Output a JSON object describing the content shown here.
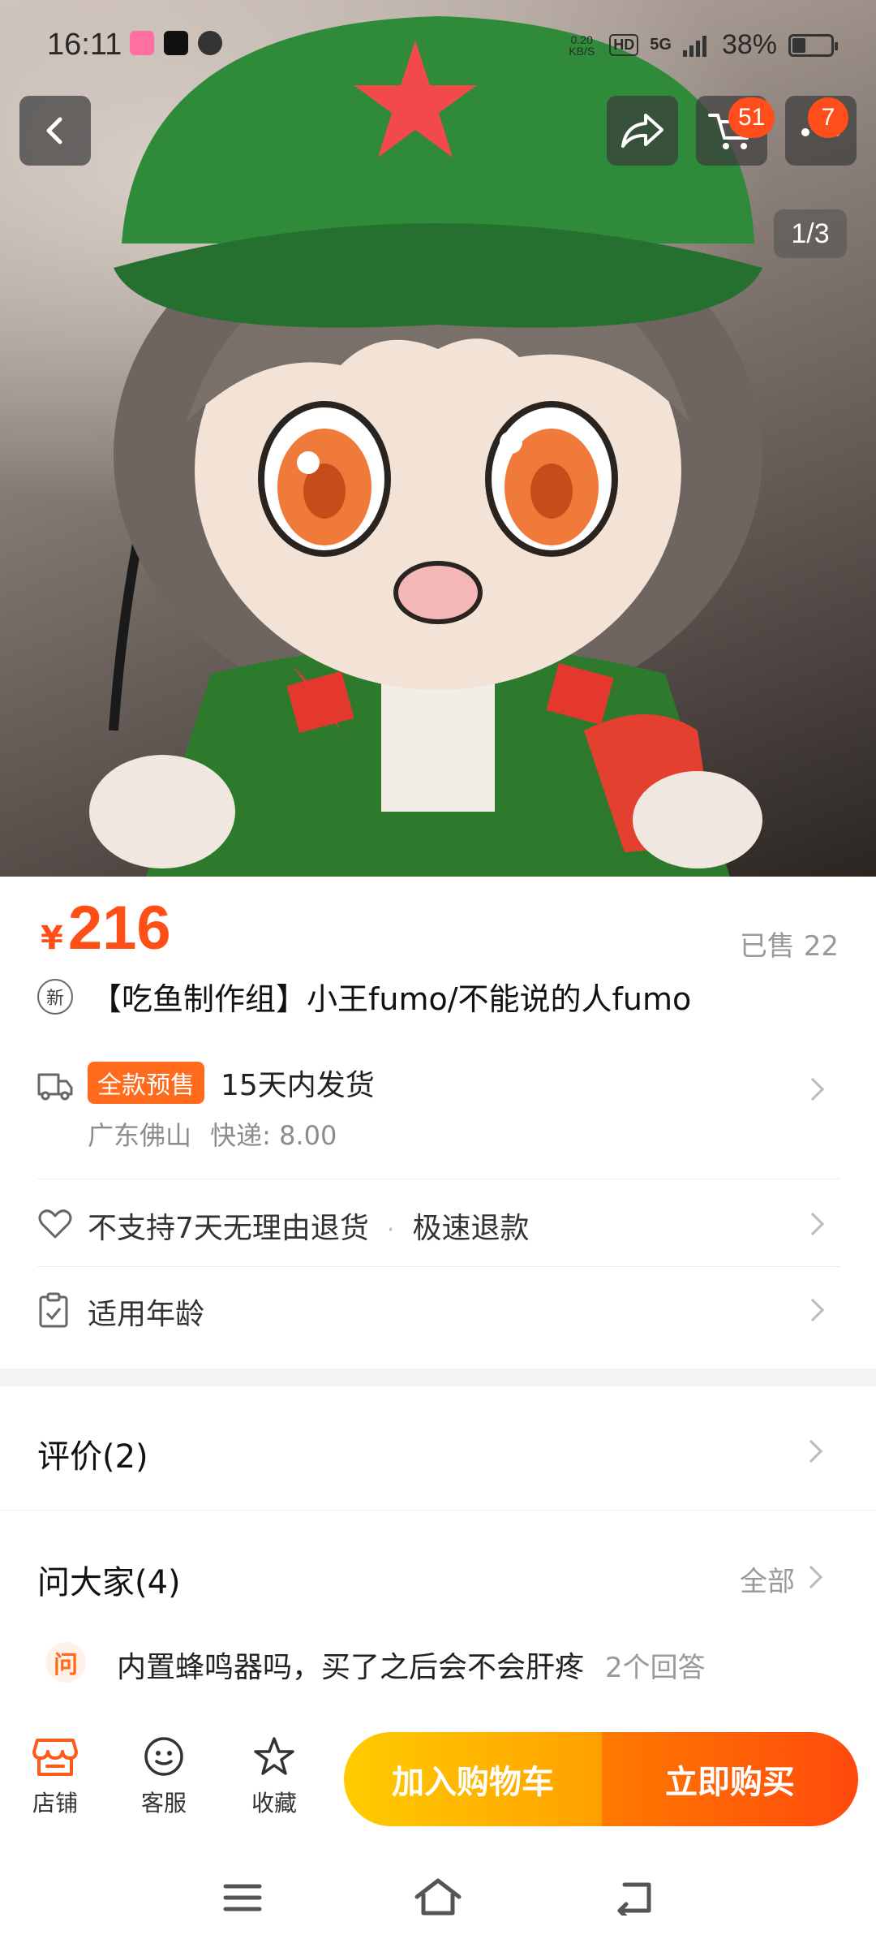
{
  "status_bar": {
    "time": "16:11",
    "net_speed_value": "0.20",
    "net_speed_unit": "KB/S",
    "hd_label": "HD",
    "network": "5G",
    "battery": "38%"
  },
  "top_bar": {
    "cart_count": "51",
    "more_count": "7",
    "pager": "1/3"
  },
  "product": {
    "currency": "¥",
    "price": "216",
    "sold": "已售 22",
    "new_label": "新",
    "title": "【吃鱼制作组】小王fumo/不能说的人fumo"
  },
  "shipping": {
    "presale_tag": "全款预售",
    "ship_time": "15天内发货",
    "origin": "广东佛山",
    "express": "快递: 8.00"
  },
  "returns": {
    "policy": "不支持7天无理由退货",
    "refund": "极速退款"
  },
  "age": {
    "label": "适用年龄"
  },
  "reviews": {
    "title": "评价(2)"
  },
  "qa": {
    "title": "问大家(4)",
    "all": "全部",
    "badge": "问",
    "question": "内置蜂鸣器吗，买了之后会不会肝疼",
    "answers": "2个回答"
  },
  "actions": {
    "shop": "店铺",
    "service": "客服",
    "favorite": "收藏",
    "add_cart": "加入购物车",
    "buy_now": "立即购买"
  },
  "colors": {
    "accent": "#ff4e16",
    "cart_gradient_start": "#ffcb00",
    "buy_gradient_end": "#ff4a0d"
  }
}
